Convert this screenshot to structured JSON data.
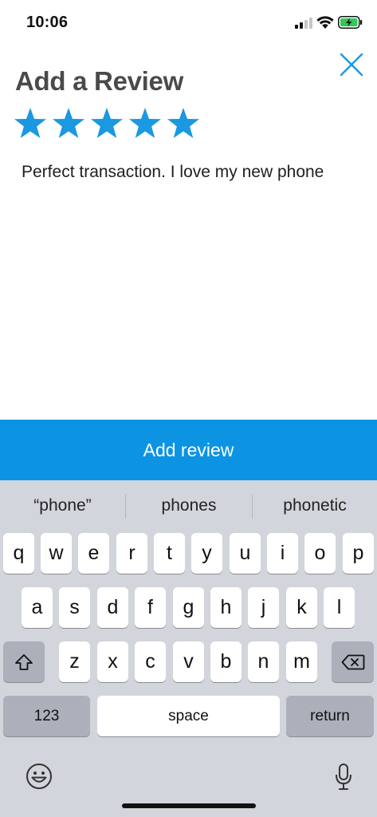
{
  "status_bar": {
    "time": "10:06",
    "signal_bars_filled": 2,
    "signal_bars_total": 4,
    "battery_state": "charging",
    "battery_color": "#34c759"
  },
  "header": {
    "title": "Add a Review",
    "close_icon": "close-icon"
  },
  "rating": {
    "value": 5,
    "max": 5,
    "star_color": "#1a98e0"
  },
  "review": {
    "text": "Perfect transaction. I love my new phone"
  },
  "submit": {
    "label": "Add review",
    "color": "#0c94e3"
  },
  "keyboard": {
    "suggestions": [
      "“phone”",
      "phones",
      "phonetic"
    ],
    "row1": [
      "q",
      "w",
      "e",
      "r",
      "t",
      "y",
      "u",
      "i",
      "o",
      "p"
    ],
    "row2": [
      "a",
      "s",
      "d",
      "f",
      "g",
      "h",
      "j",
      "k",
      "l"
    ],
    "row3": [
      "z",
      "x",
      "c",
      "v",
      "b",
      "n",
      "m"
    ],
    "numbers_label": "123",
    "space_label": "space",
    "return_label": "return",
    "shift_icon": "shift-icon",
    "delete_icon": "delete-icon",
    "emoji_icon": "emoji-icon",
    "mic_icon": "microphone-icon"
  }
}
